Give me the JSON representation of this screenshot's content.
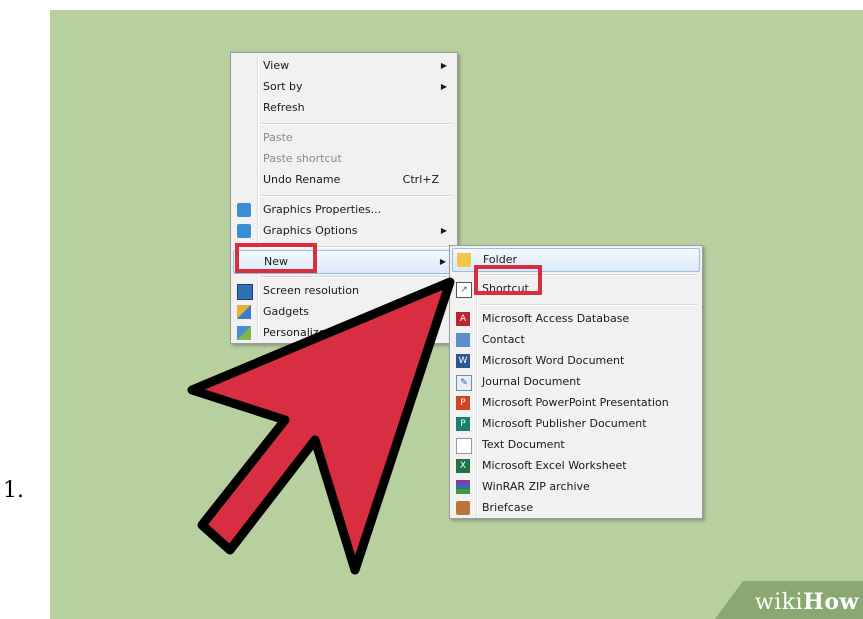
{
  "step_number": "1.",
  "context_menu": {
    "items": [
      {
        "label": "View",
        "submenu": true
      },
      {
        "label": "Sort by",
        "submenu": true
      },
      {
        "label": "Refresh"
      },
      {
        "label": "Paste",
        "disabled": true
      },
      {
        "label": "Paste shortcut",
        "disabled": true
      },
      {
        "label": "Undo Rename",
        "shortcut": "Ctrl+Z"
      },
      {
        "label": "Graphics Properties...",
        "icon": "graphics-icon"
      },
      {
        "label": "Graphics Options",
        "icon": "graphics-icon",
        "submenu": true
      },
      {
        "label": "New",
        "submenu": true,
        "highlighted": true
      },
      {
        "label": "Screen resolution",
        "icon": "monitor-icon"
      },
      {
        "label": "Gadgets",
        "icon": "gadgets-icon"
      },
      {
        "label": "Personalize",
        "icon": "personalize-icon"
      }
    ]
  },
  "new_submenu": {
    "items": [
      {
        "label": "Folder",
        "icon": "folder-icon"
      },
      {
        "label": "Shortcut",
        "icon": "shortcut-icon",
        "highlighted": true
      },
      {
        "label": "Microsoft Access Database",
        "icon": "access-icon"
      },
      {
        "label": "Contact",
        "icon": "contact-icon"
      },
      {
        "label": "Microsoft Word Document",
        "icon": "word-icon"
      },
      {
        "label": "Journal Document",
        "icon": "journal-icon"
      },
      {
        "label": "Microsoft PowerPoint Presentation",
        "icon": "powerpoint-icon"
      },
      {
        "label": "Microsoft Publisher Document",
        "icon": "publisher-icon"
      },
      {
        "label": "Text Document",
        "icon": "text-document-icon"
      },
      {
        "label": "Microsoft Excel Worksheet",
        "icon": "excel-icon"
      },
      {
        "label": "WinRAR ZIP archive",
        "icon": "winrar-icon"
      },
      {
        "label": "Briefcase",
        "icon": "briefcase-icon"
      }
    ]
  },
  "watermark": {
    "wiki": "wiki",
    "how": "How"
  },
  "colors": {
    "desktop_background": "#b8cfa0",
    "highlight_red": "#d72f41",
    "arrow_red": "#d72f41"
  }
}
